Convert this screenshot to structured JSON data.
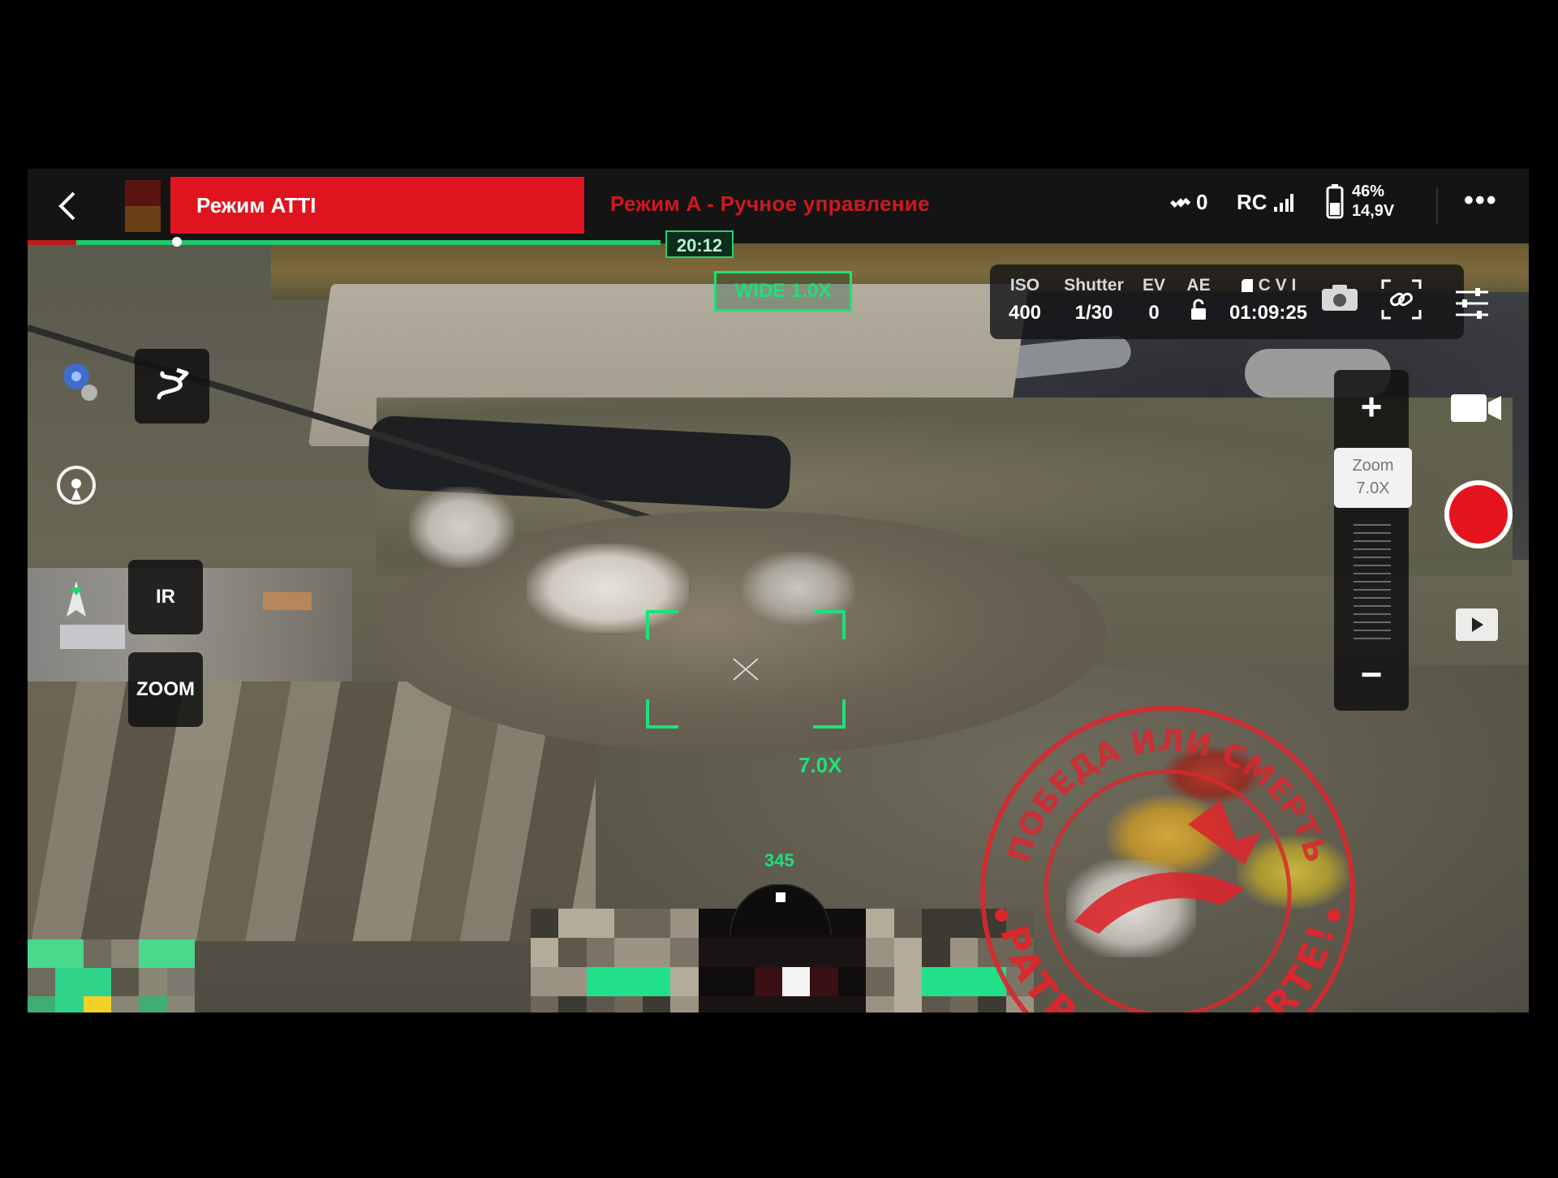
{
  "topbar": {
    "mode_label": "Режим ATTI",
    "mode_sub": "Режим A - Ручное управление",
    "satellites": "0",
    "rc_label": "RC",
    "battery_percent": "46%",
    "battery_voltage": "14,9V",
    "more_label": "•••"
  },
  "flight": {
    "time": "20:12",
    "progress_fraction": 0.06
  },
  "lens": {
    "wide_label": "WIDE  1.0X"
  },
  "camera": {
    "iso_label": "ISO",
    "iso_value": "400",
    "shutter_label": "Shutter",
    "shutter_value": "1/30",
    "ev_label": "EV",
    "ev_value": "0",
    "ae_label": "AE",
    "storage_label": "C V I",
    "record_time": "01:09:25"
  },
  "left_controls": {
    "ir_label": "IR",
    "zoom_label": "ZOOM"
  },
  "zoom_slider": {
    "plus": "+",
    "title": "Zoom",
    "value": "7.0X",
    "minus": "−"
  },
  "reticle": {
    "zoom": "7.0X",
    "heading": "345"
  },
  "watermark": {
    "top_text": "ПОБЕДА ИЛИ СМЕРТЬ",
    "bottom_text": "PATRIA O MUERTE!"
  },
  "colors": {
    "accent_green": "#1fe07a",
    "mode_red": "#e0141e",
    "record_red": "#e4141e",
    "seal_red": "#d9282e"
  }
}
